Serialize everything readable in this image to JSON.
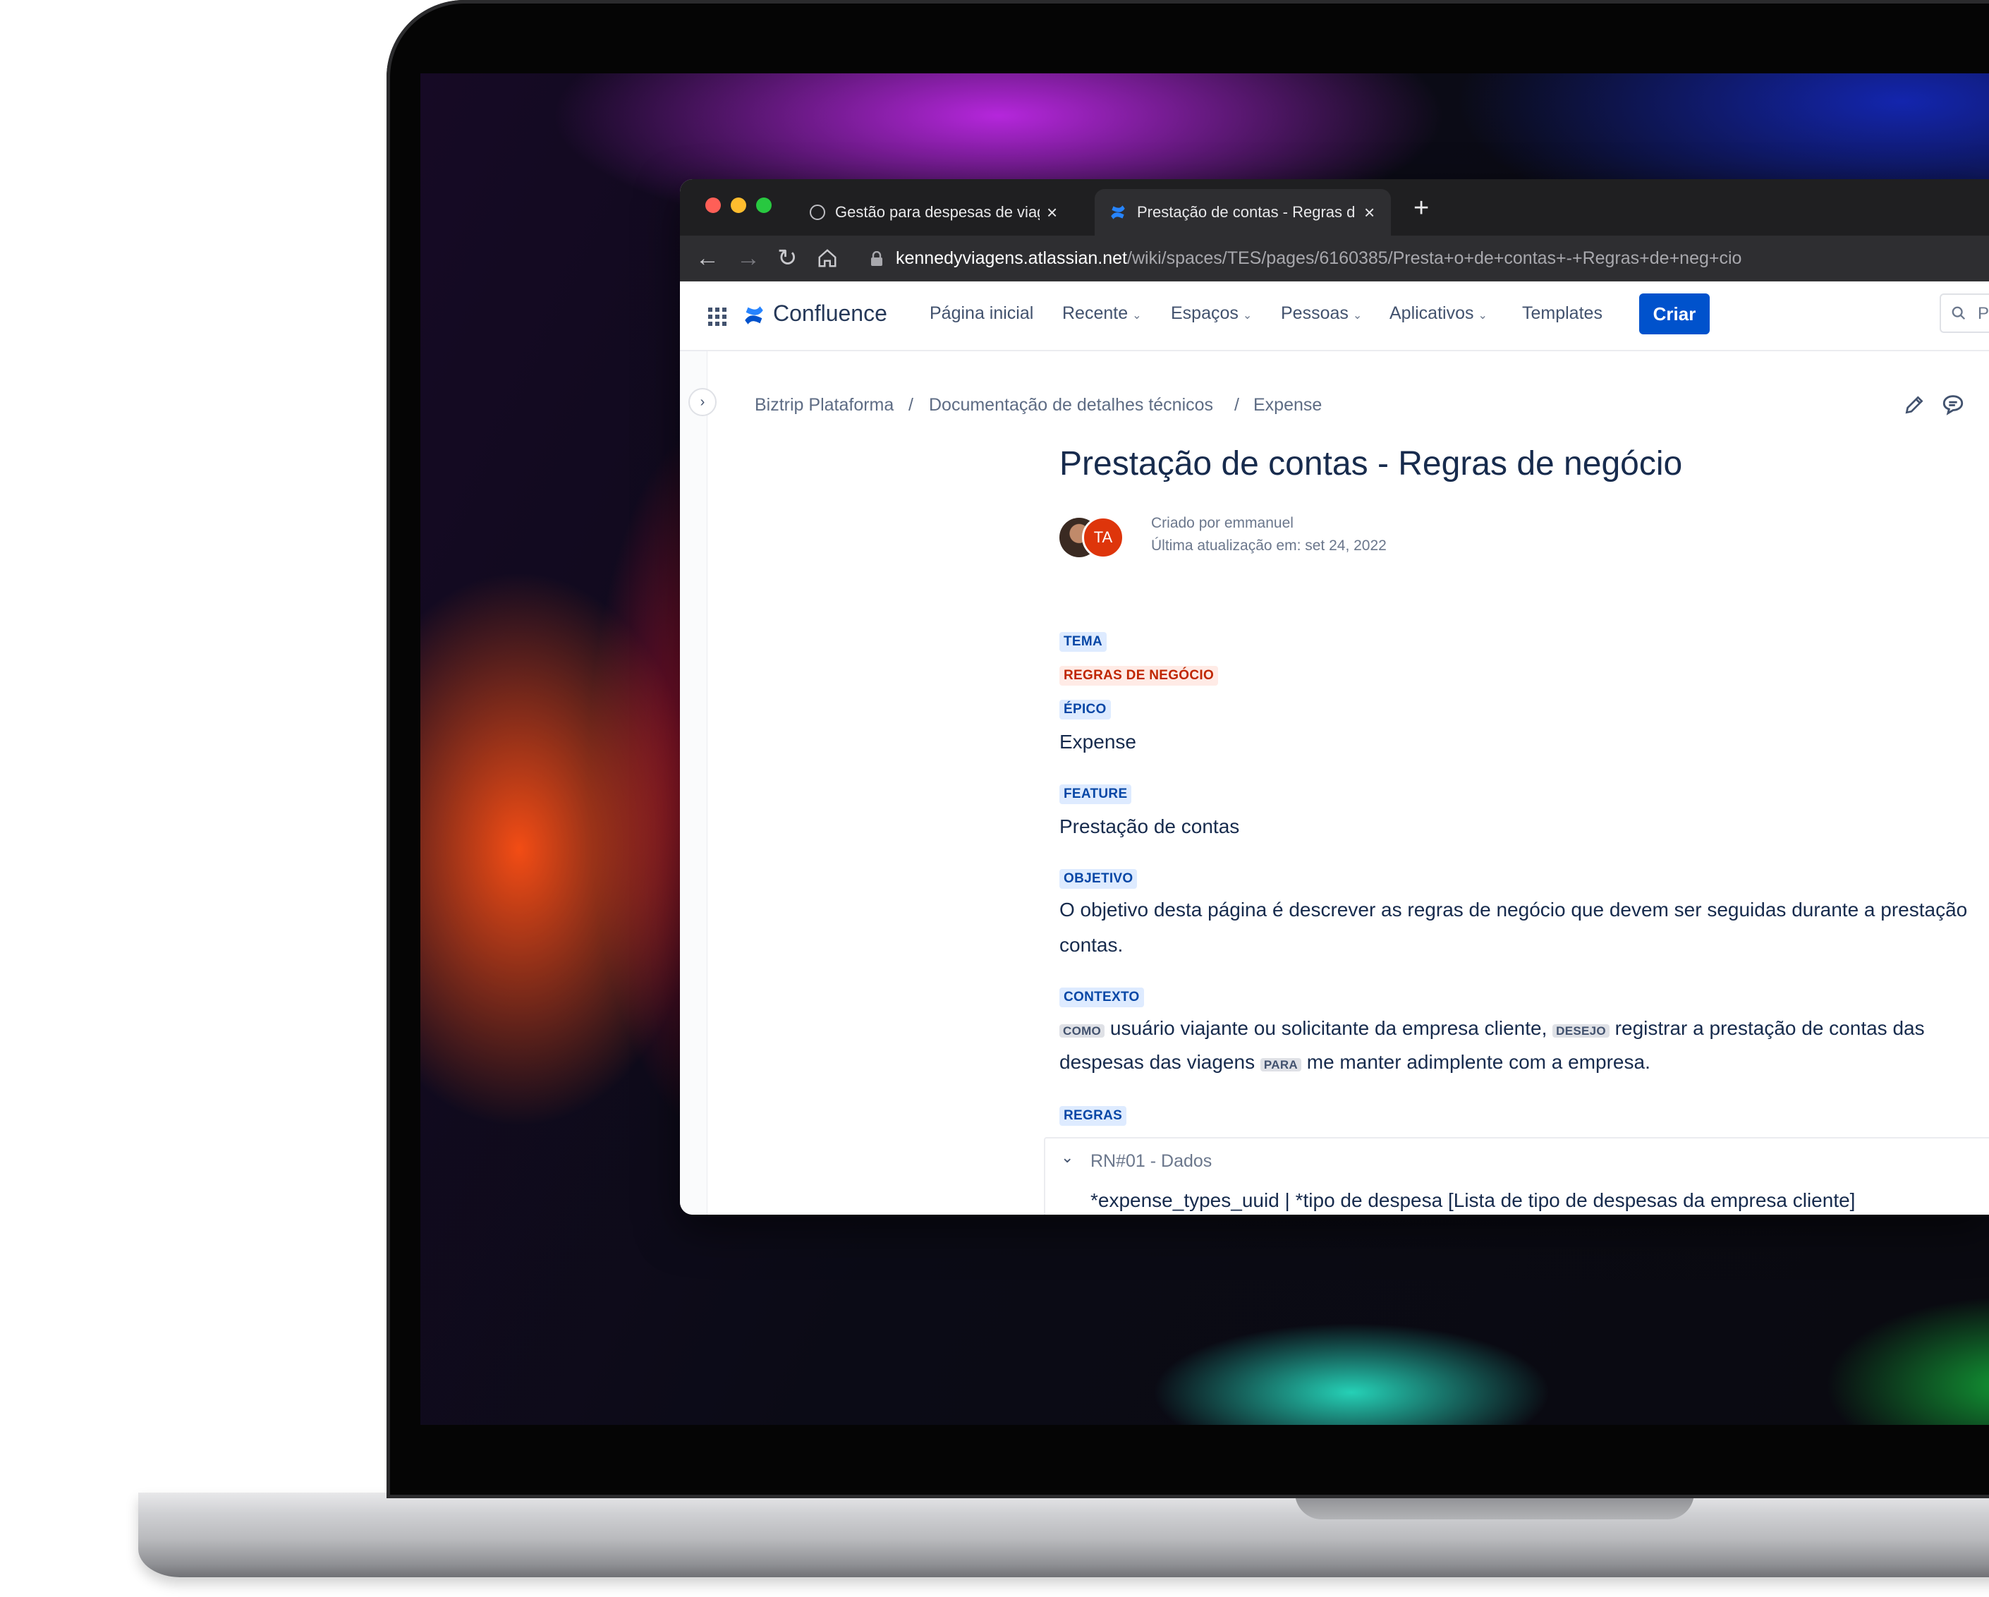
{
  "browser": {
    "tabs": [
      {
        "title": "Gestão para despesas de viage",
        "active": false
      },
      {
        "title": "Prestação de contas - Regras d",
        "active": true
      }
    ],
    "new_tab": "+",
    "url_host": "kennedyviagens.atlassian.net",
    "url_path": "/wiki/spaces/TES/pages/6160385/Presta+o+de+contas+-+Regras+de+neg+cio"
  },
  "header": {
    "logo": "Confluence",
    "nav": [
      {
        "label": "Página inicial",
        "dropdown": false
      },
      {
        "label": "Recente",
        "dropdown": true
      },
      {
        "label": "Espaços",
        "dropdown": true
      },
      {
        "label": "Pessoas",
        "dropdown": true
      },
      {
        "label": "Aplicativos",
        "dropdown": true
      },
      {
        "label": "Templates",
        "dropdown": false
      }
    ],
    "create_label": "Criar",
    "search_placeholder": "P"
  },
  "breadcrumb": [
    "Biztrip Plataforma",
    "Documentação de detalhes técnicos",
    "Expense"
  ],
  "page": {
    "title": "Prestação de contas - Regras de negócio",
    "avatar_initials": "TA",
    "created_by": "Criado por emmanuel",
    "last_updated": "Última atualização em: set 24, 2022",
    "tema_label": "TEMA",
    "tema_value": "REGRAS DE NEGÓCIO",
    "epico_label": "ÉPICO",
    "epico_value": "Expense",
    "feature_label": "FEATURE",
    "feature_value": "Prestação de contas",
    "objetivo_label": "OBJETIVO",
    "objetivo_line1": "O objetivo desta página é descrever as regras de negócio que devem ser seguidas durante a prestação",
    "objetivo_line2": "contas.",
    "contexto_label": "CONTEXTO",
    "como_tag": "COMO",
    "contexto_part1": " usuário viajante ou solicitante da empresa cliente, ",
    "desejo_tag": "DESEJO",
    "contexto_part2": " registrar a prestação de contas das",
    "contexto_part3": "despesas das viagens ",
    "para_tag": "PARA",
    "contexto_part4": " me manter adimplente com a empresa.",
    "regras_label": "REGRAS",
    "rule_title": "RN#01 - Dados",
    "rule_line": "*expense_types_uuid | *tipo de despesa [Lista de tipo de despesas da empresa cliente]"
  },
  "colors": {
    "primary": "#0052cc",
    "lozenge_blue_bg": "#deebff",
    "lozenge_red_bg": "#ffebe6",
    "text": "#172b4d"
  }
}
